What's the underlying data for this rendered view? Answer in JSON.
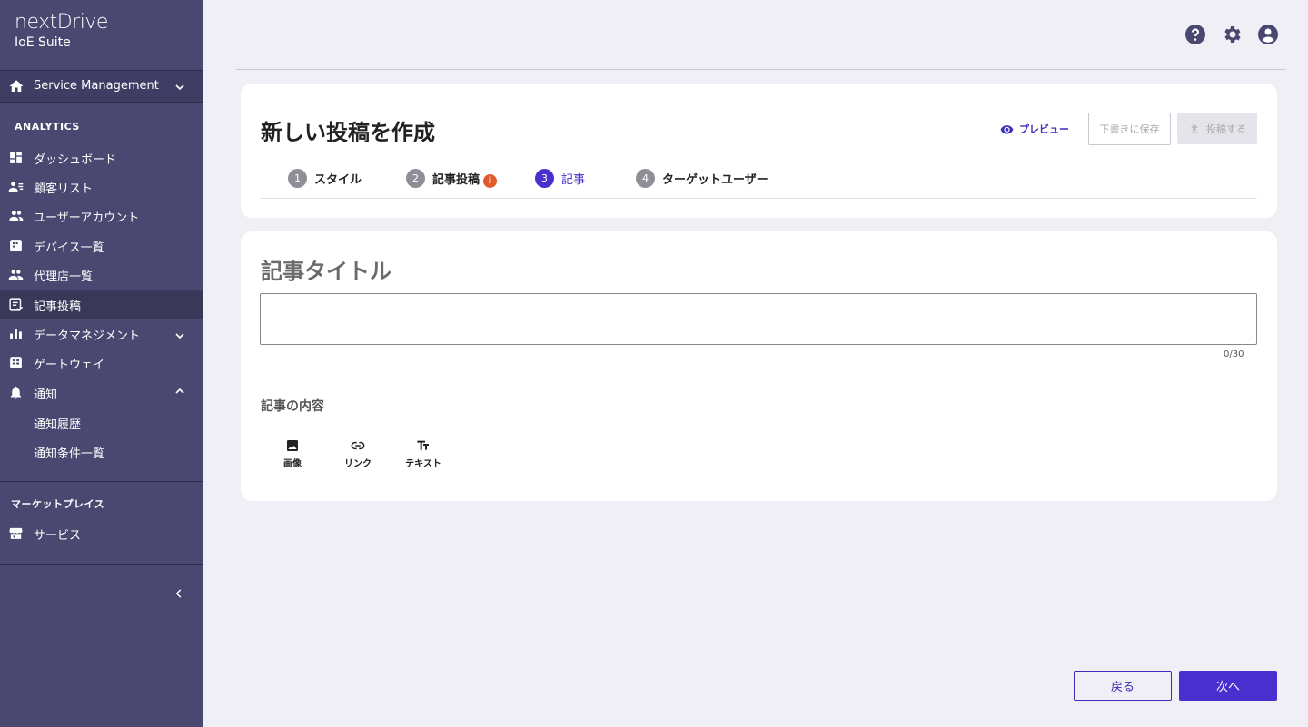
{
  "sidebar": {
    "brand_name": "nextDrive",
    "brand_sub": "IoE Suite",
    "service_label": "Service Management",
    "analytics_title": "ANALYTICS",
    "items": [
      {
        "label": "ダッシュボード",
        "icon": "dashboard-icon"
      },
      {
        "label": "顧客リスト",
        "icon": "customer-list-icon"
      },
      {
        "label": "ユーザーアカウント",
        "icon": "users-icon"
      },
      {
        "label": "デバイス一覧",
        "icon": "device-icon"
      },
      {
        "label": "代理店一覧",
        "icon": "agency-icon"
      },
      {
        "label": "記事投稿",
        "icon": "article-icon"
      },
      {
        "label": "データマネジメント",
        "icon": "chart-icon"
      },
      {
        "label": "ゲートウェイ",
        "icon": "gateway-icon"
      },
      {
        "label": "通知",
        "icon": "bell-icon"
      }
    ],
    "notification_sub": [
      "通知履歴",
      "通知条件一覧"
    ],
    "marketplace_title": "マーケットプレイス",
    "marketplace_item": "サービス"
  },
  "header": {
    "icons": [
      "help-icon",
      "gear-icon",
      "account-icon"
    ]
  },
  "editor": {
    "page_title": "新しい投稿を作成",
    "preview_label": "プレビュー",
    "draft_label": "下書きに保存",
    "post_label": "投稿する",
    "steps": [
      {
        "num": "1",
        "label": "スタイル"
      },
      {
        "num": "2",
        "label": "記事投稿"
      },
      {
        "num": "3",
        "label": "記事"
      },
      {
        "num": "4",
        "label": "ターゲットユーザー"
      }
    ],
    "current_step": 3,
    "section_title": "記事タイトル",
    "title_value": "",
    "counter": "0/30",
    "content_label": "記事の内容",
    "tools": [
      {
        "label": "画像",
        "icon": "image-icon"
      },
      {
        "label": "リンク",
        "icon": "link-icon"
      },
      {
        "label": "テキスト",
        "icon": "text-icon"
      }
    ]
  },
  "footer": {
    "back_label": "戻る",
    "next_label": "次へ"
  },
  "colors": {
    "sidebar_bg": "#4a4870",
    "accent": "#4a2fd0",
    "warning": "#e05a2a",
    "page_bg": "#efeff5"
  }
}
